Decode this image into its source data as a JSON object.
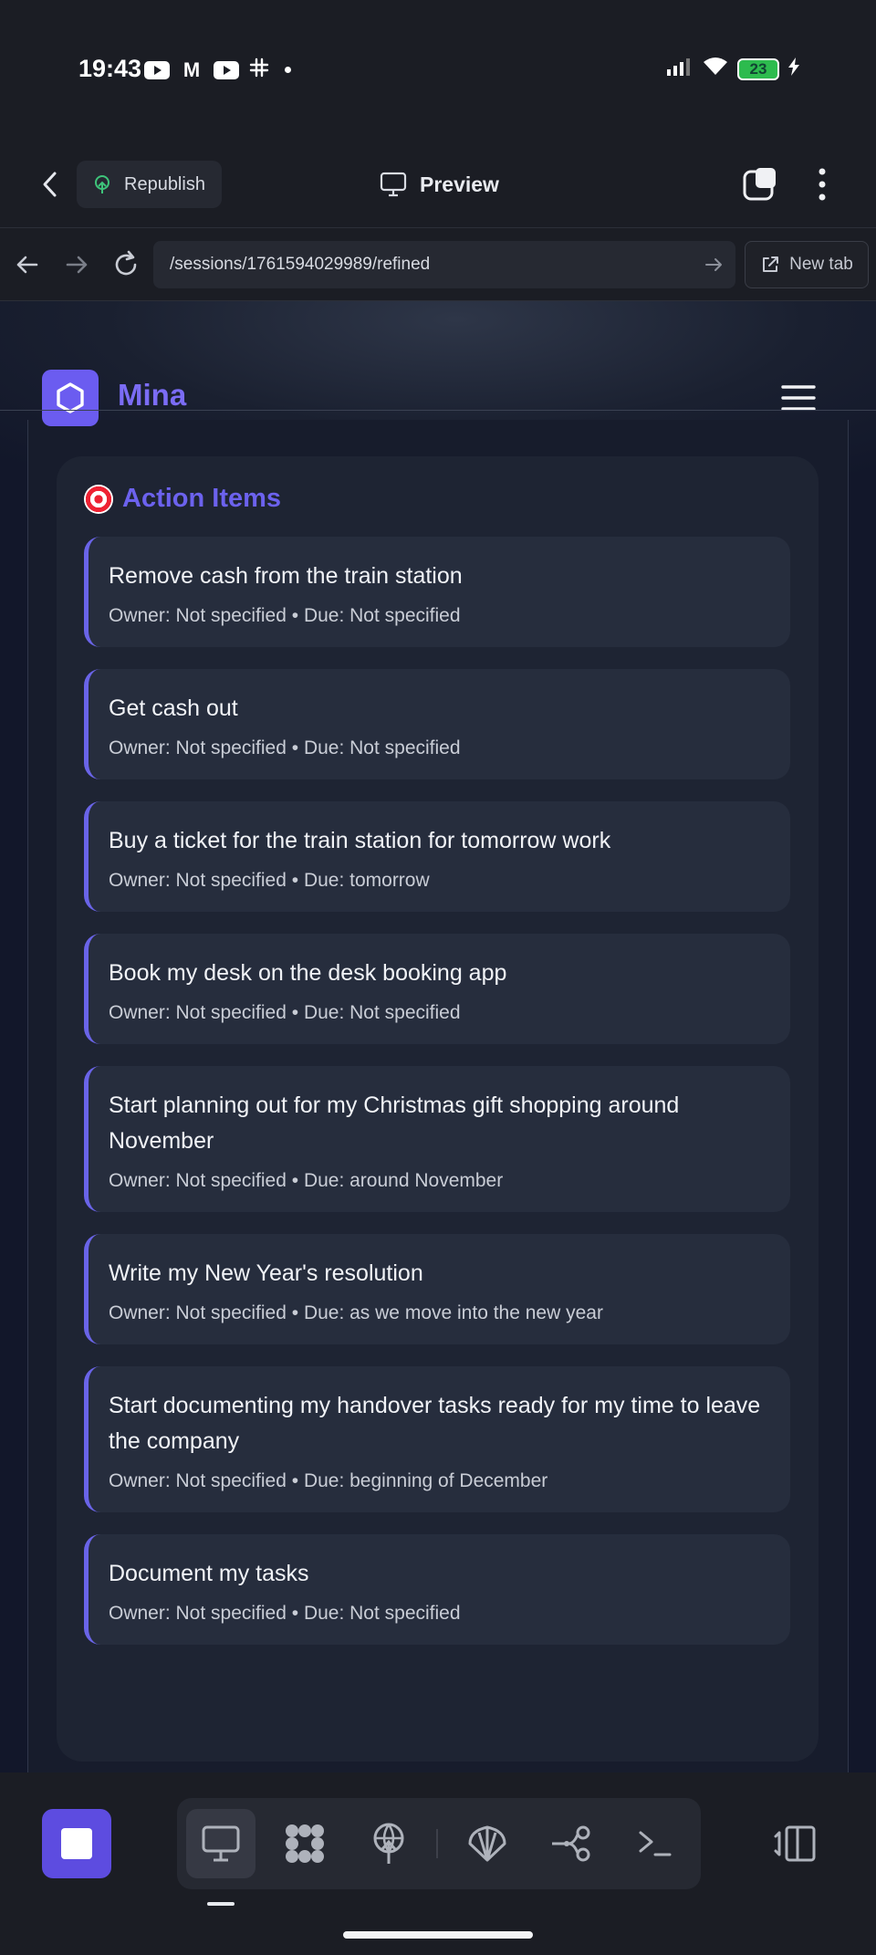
{
  "status_bar": {
    "time": "19:43",
    "notification_icons": [
      "youtube-icon",
      "gmail-icon",
      "youtube-icon",
      "slack-icon",
      "dot-icon"
    ],
    "battery_level": "23"
  },
  "app_bar": {
    "republish_label": "Republish",
    "preview_label": "Preview"
  },
  "browser": {
    "url": "/sessions/1761594029989/refined",
    "new_tab_label": "New tab"
  },
  "site": {
    "name": "Mina"
  },
  "action_items": {
    "heading": "Action Items",
    "items": [
      {
        "title": "Remove cash from the train station",
        "meta": "Owner: Not specified • Due: Not specified"
      },
      {
        "title": "Get cash out",
        "meta": "Owner: Not specified • Due: Not specified"
      },
      {
        "title": "Buy a ticket for the train station for tomorrow work",
        "meta": "Owner: Not specified • Due: tomorrow"
      },
      {
        "title": "Book my desk on the desk booking app",
        "meta": "Owner: Not specified • Due: Not specified"
      },
      {
        "title": "Start planning out for my Christmas gift shopping around November",
        "meta": "Owner: Not specified • Due: around November"
      },
      {
        "title": "Write my New Year's resolution",
        "meta": "Owner: Not specified • Due: as we move into the new year"
      },
      {
        "title": "Start documenting my handover tasks ready for my time to leave the company",
        "meta": "Owner: Not specified • Due: beginning of December"
      },
      {
        "title": "Document my tasks",
        "meta": "Owner: Not specified • Due: Not specified"
      }
    ]
  },
  "colors": {
    "accent": "#6b5cf0",
    "card_bg": "#262d3d",
    "item_border": "#6a64e8"
  }
}
